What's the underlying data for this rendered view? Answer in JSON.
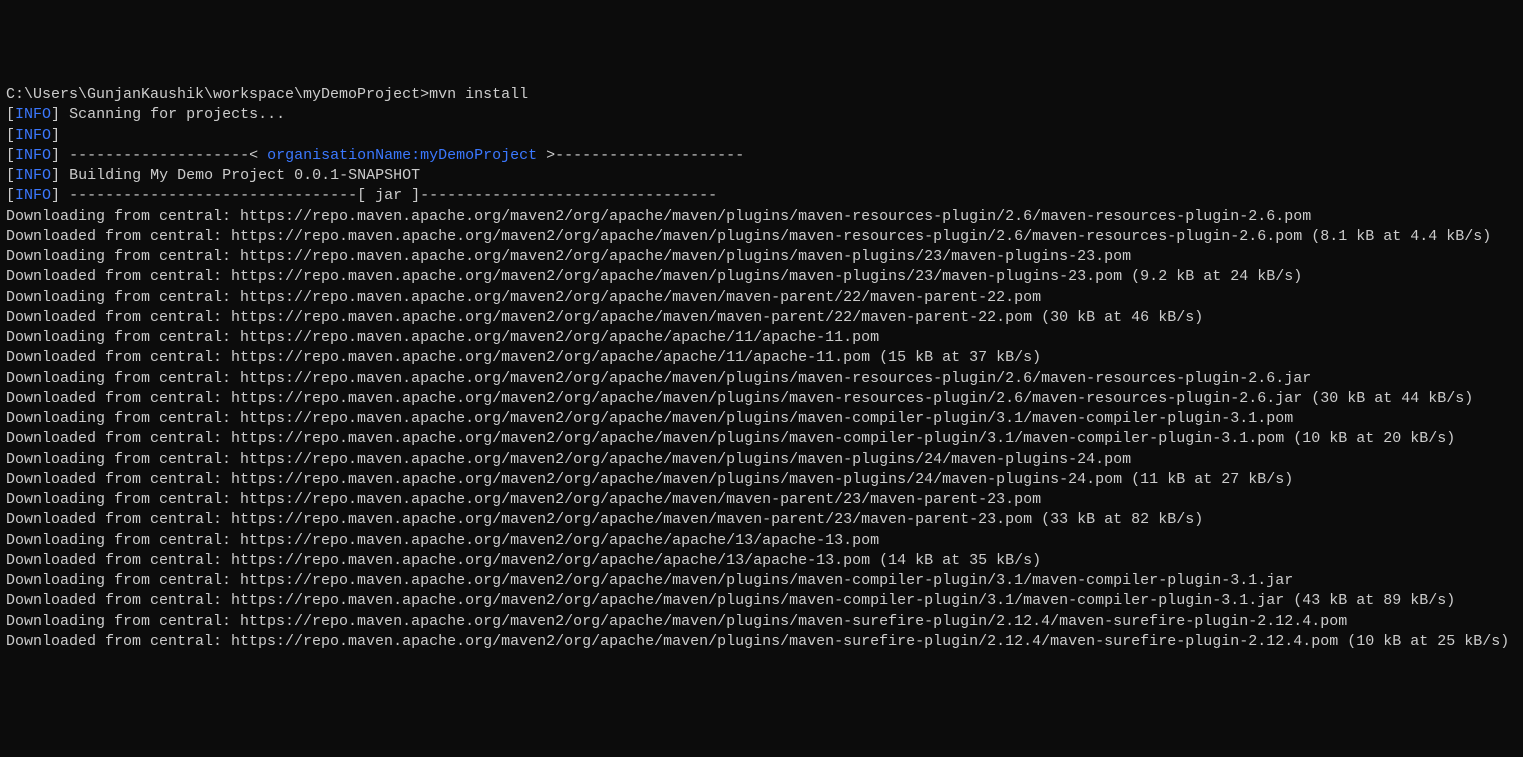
{
  "prompt": "C:\\Users\\GunjanKaushik\\workspace\\myDemoProject>mvn install",
  "info_label": "INFO",
  "scanning": "Scanning for projects...",
  "divider_left": "--------------------< ",
  "project_ref": "organisationName:myDemoProject",
  "divider_right": " >---------------------",
  "building": "Building My Demo Project 0.0.1-SNAPSHOT",
  "jar_divider": "--------------------------------[ jar ]---------------------------------",
  "lines": [
    "Downloading from central: https://repo.maven.apache.org/maven2/org/apache/maven/plugins/maven-resources-plugin/2.6/maven-resources-plugin-2.6.pom",
    "Downloaded from central: https://repo.maven.apache.org/maven2/org/apache/maven/plugins/maven-resources-plugin/2.6/maven-resources-plugin-2.6.pom (8.1 kB at 4.4 kB/s)",
    "Downloading from central: https://repo.maven.apache.org/maven2/org/apache/maven/plugins/maven-plugins/23/maven-plugins-23.pom",
    "Downloaded from central: https://repo.maven.apache.org/maven2/org/apache/maven/plugins/maven-plugins/23/maven-plugins-23.pom (9.2 kB at 24 kB/s)",
    "Downloading from central: https://repo.maven.apache.org/maven2/org/apache/maven/maven-parent/22/maven-parent-22.pom",
    "Downloaded from central: https://repo.maven.apache.org/maven2/org/apache/maven/maven-parent/22/maven-parent-22.pom (30 kB at 46 kB/s)",
    "Downloading from central: https://repo.maven.apache.org/maven2/org/apache/apache/11/apache-11.pom",
    "Downloaded from central: https://repo.maven.apache.org/maven2/org/apache/apache/11/apache-11.pom (15 kB at 37 kB/s)",
    "Downloading from central: https://repo.maven.apache.org/maven2/org/apache/maven/plugins/maven-resources-plugin/2.6/maven-resources-plugin-2.6.jar",
    "Downloaded from central: https://repo.maven.apache.org/maven2/org/apache/maven/plugins/maven-resources-plugin/2.6/maven-resources-plugin-2.6.jar (30 kB at 44 kB/s)",
    "Downloading from central: https://repo.maven.apache.org/maven2/org/apache/maven/plugins/maven-compiler-plugin/3.1/maven-compiler-plugin-3.1.pom",
    "Downloaded from central: https://repo.maven.apache.org/maven2/org/apache/maven/plugins/maven-compiler-plugin/3.1/maven-compiler-plugin-3.1.pom (10 kB at 20 kB/s)",
    "Downloading from central: https://repo.maven.apache.org/maven2/org/apache/maven/plugins/maven-plugins/24/maven-plugins-24.pom",
    "Downloaded from central: https://repo.maven.apache.org/maven2/org/apache/maven/plugins/maven-plugins/24/maven-plugins-24.pom (11 kB at 27 kB/s)",
    "Downloading from central: https://repo.maven.apache.org/maven2/org/apache/maven/maven-parent/23/maven-parent-23.pom",
    "Downloaded from central: https://repo.maven.apache.org/maven2/org/apache/maven/maven-parent/23/maven-parent-23.pom (33 kB at 82 kB/s)",
    "Downloading from central: https://repo.maven.apache.org/maven2/org/apache/apache/13/apache-13.pom",
    "Downloaded from central: https://repo.maven.apache.org/maven2/org/apache/apache/13/apache-13.pom (14 kB at 35 kB/s)",
    "Downloading from central: https://repo.maven.apache.org/maven2/org/apache/maven/plugins/maven-compiler-plugin/3.1/maven-compiler-plugin-3.1.jar",
    "Downloaded from central: https://repo.maven.apache.org/maven2/org/apache/maven/plugins/maven-compiler-plugin/3.1/maven-compiler-plugin-3.1.jar (43 kB at 89 kB/s)",
    "Downloading from central: https://repo.maven.apache.org/maven2/org/apache/maven/plugins/maven-surefire-plugin/2.12.4/maven-surefire-plugin-2.12.4.pom",
    "Downloaded from central: https://repo.maven.apache.org/maven2/org/apache/maven/plugins/maven-surefire-plugin/2.12.4/maven-surefire-plugin-2.12.4.pom (10 kB at 25 kB/s)"
  ]
}
